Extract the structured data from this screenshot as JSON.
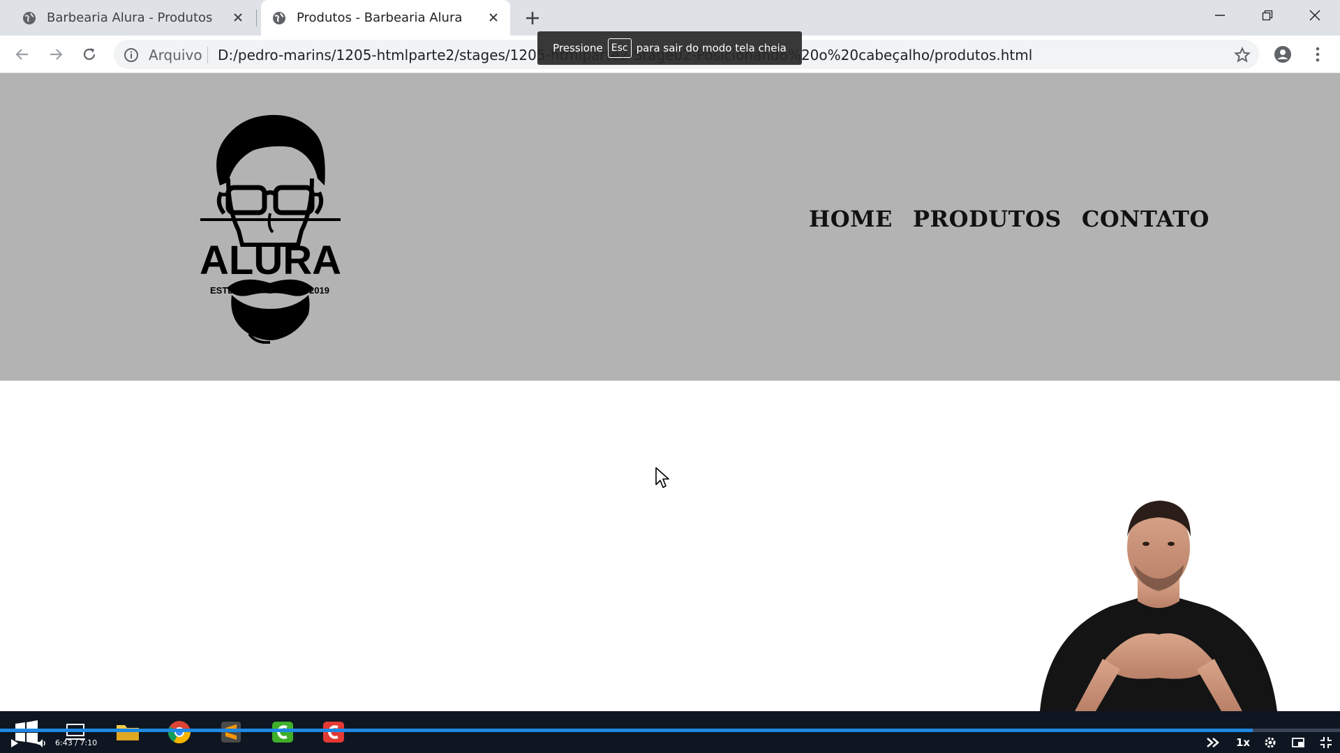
{
  "browser": {
    "tabs": [
      {
        "title": "Barbearia Alura - Produtos",
        "active": false
      },
      {
        "title": "Produtos - Barbearia Alura",
        "active": true
      }
    ],
    "address": {
      "scheme_label": "Arquivo",
      "url": "D:/pedro-marins/1205-htmlparte2/stages/1205-htmlparte2-Stage02-Posicionando%20o%20cabeçalho/produtos.html"
    },
    "fullscreen_toast": {
      "before": "Pressione",
      "key": "Esc",
      "after": "para sair do modo tela cheia"
    }
  },
  "site": {
    "logo": {
      "wordmark": "ALURA",
      "left": "ESTD",
      "right": "2019"
    },
    "nav": {
      "home": "HOME",
      "produtos": "PRODUTOS",
      "contato": "CONTATO"
    },
    "header_color": "#b3b3b3"
  },
  "player": {
    "time_current": "6:43",
    "time_total": "7:10",
    "progress": 0.935,
    "speed": "1x",
    "accent": "#1e88e5"
  }
}
